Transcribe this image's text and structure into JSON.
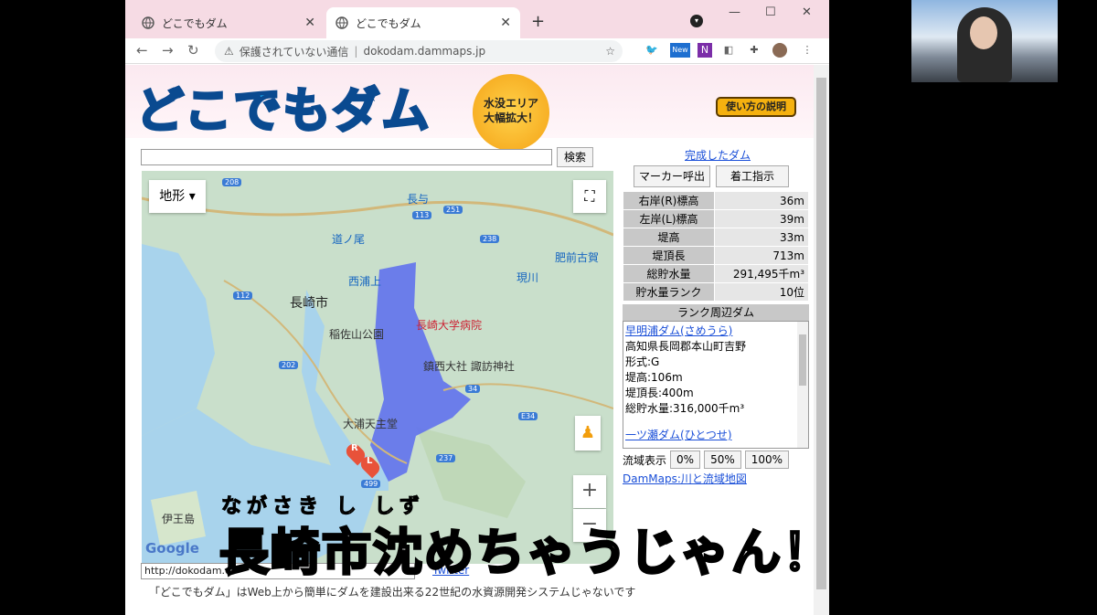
{
  "tabs": [
    {
      "title": "どこでもダム",
      "active": false
    },
    {
      "title": "どこでもダム",
      "active": true
    }
  ],
  "window": {
    "minimize": "—",
    "maximize": "☐",
    "close": "✕"
  },
  "address_bar": {
    "security": "保護されていない通信",
    "url": "dokodam.dammaps.jp"
  },
  "extensions": {
    "new_badge": "New"
  },
  "site": {
    "logo": "どこでもダム",
    "badge_line1": "水没エリア",
    "badge_line2": "大幅拡大！",
    "howto_button": "使い方の説明",
    "search_button": "検索"
  },
  "map": {
    "terrain_control": "地形",
    "labels": {
      "nagayo": "長与",
      "michinoo": "道ノ尾",
      "nishiurakami": "西浦上",
      "nagasaki_city": "長崎市",
      "inasayama": "稲佐山公園",
      "hospital": "長崎大学病院",
      "shrine": "鎮西大社 諏訪神社",
      "oura": "大浦天主堂",
      "hizen_koga": "肥前古賀",
      "utsutsugawa": "現川",
      "ioujima": "伊王島",
      "google": "Google"
    },
    "roads": [
      "208",
      "113",
      "112",
      "202",
      "237",
      "34",
      "E34",
      "499",
      "251",
      "238"
    ],
    "markers": [
      "R",
      "L"
    ]
  },
  "panel": {
    "completed_link": "完成したダム",
    "marker_button": "マーカー呼出",
    "construct_button": "着工指示",
    "stats": [
      {
        "key": "右岸(R)標高",
        "value": "36m"
      },
      {
        "key": "左岸(L)標高",
        "value": "39m"
      },
      {
        "key": "堤高",
        "value": "33m"
      },
      {
        "key": "堤頂長",
        "value": "713m"
      },
      {
        "key": "総貯水量",
        "value": "291,495千m³"
      },
      {
        "key": "貯水量ランク",
        "value": "10位"
      }
    ],
    "rank_header": "ランク周辺ダム",
    "rank_entry": {
      "name": "早明浦ダム(さめうら)",
      "location": "高知県長岡郡本山町吉野",
      "type": "形式:G",
      "height": "堤高:106m",
      "length": "堤頂長:400m",
      "volume": "総貯水量:316,000千m³",
      "next": "一ツ瀬ダム(ひとつせ)"
    },
    "basin_label": "流域表示",
    "basin_buttons": [
      "0%",
      "50%",
      "100%"
    ],
    "dammaps_link": "DamMaps:川と流域地図"
  },
  "bottom": {
    "url_field": "http://dokodam.d",
    "twitter": "Twitter",
    "footer": "「どこでもダム」はWeb上から簡単にダムを建設出来る22世紀の水資源開発システムじゃないです"
  },
  "overlay": {
    "ruby": "ながさき し しず",
    "caption": "長崎市沈めちゃうじゃん！"
  },
  "colors": {
    "tabstrip": "#f6dbe4",
    "reservoir": "#5b6cf0",
    "link": "#1a4fd8"
  }
}
